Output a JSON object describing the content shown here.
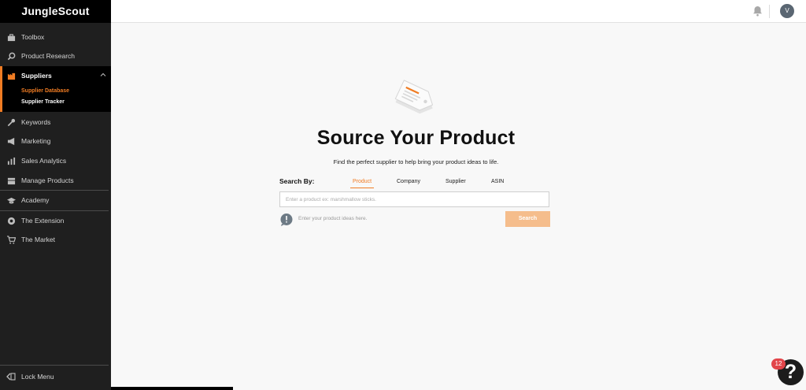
{
  "brand": "JungleScout",
  "sidebar": {
    "items": [
      {
        "label": "Toolbox",
        "icon": "toolbox-icon"
      },
      {
        "label": "Product Research",
        "icon": "search-icon"
      },
      {
        "label": "Suppliers",
        "icon": "factory-icon"
      },
      {
        "label": "Keywords",
        "icon": "key-icon"
      },
      {
        "label": "Marketing",
        "icon": "megaphone-icon"
      },
      {
        "label": "Sales Analytics",
        "icon": "bar-chart-icon"
      },
      {
        "label": "Manage Products",
        "icon": "boxes-icon"
      },
      {
        "label": "Academy",
        "icon": "graduation-cap-icon"
      },
      {
        "label": "The Extension",
        "icon": "chrome-icon"
      },
      {
        "label": "The Market",
        "icon": "cart-icon"
      }
    ],
    "sub_items": [
      {
        "label": "Supplier Database"
      },
      {
        "label": "Supplier Tracker"
      }
    ],
    "lock_menu": "Lock Menu"
  },
  "topbar": {
    "avatar_initial": "V"
  },
  "main": {
    "title": "Source Your Product",
    "subtitle": "Find the perfect supplier to help bring your product ideas to life.",
    "search_by_label": "Search By:",
    "tabs": [
      {
        "label": "Product"
      },
      {
        "label": "Company"
      },
      {
        "label": "Supplier"
      },
      {
        "label": "ASIN"
      }
    ],
    "search_placeholder": "Enter a product ex: marshmallow sticks.",
    "hint": "Enter your product ideas here.",
    "search_button": "Search"
  },
  "help": {
    "badge_count": "12",
    "glyph": "?"
  },
  "colors": {
    "accent": "#f07c23",
    "sidebar_bg": "#1f1f1f",
    "button_bg": "#f5bd8c",
    "badge": "#e2454a"
  }
}
